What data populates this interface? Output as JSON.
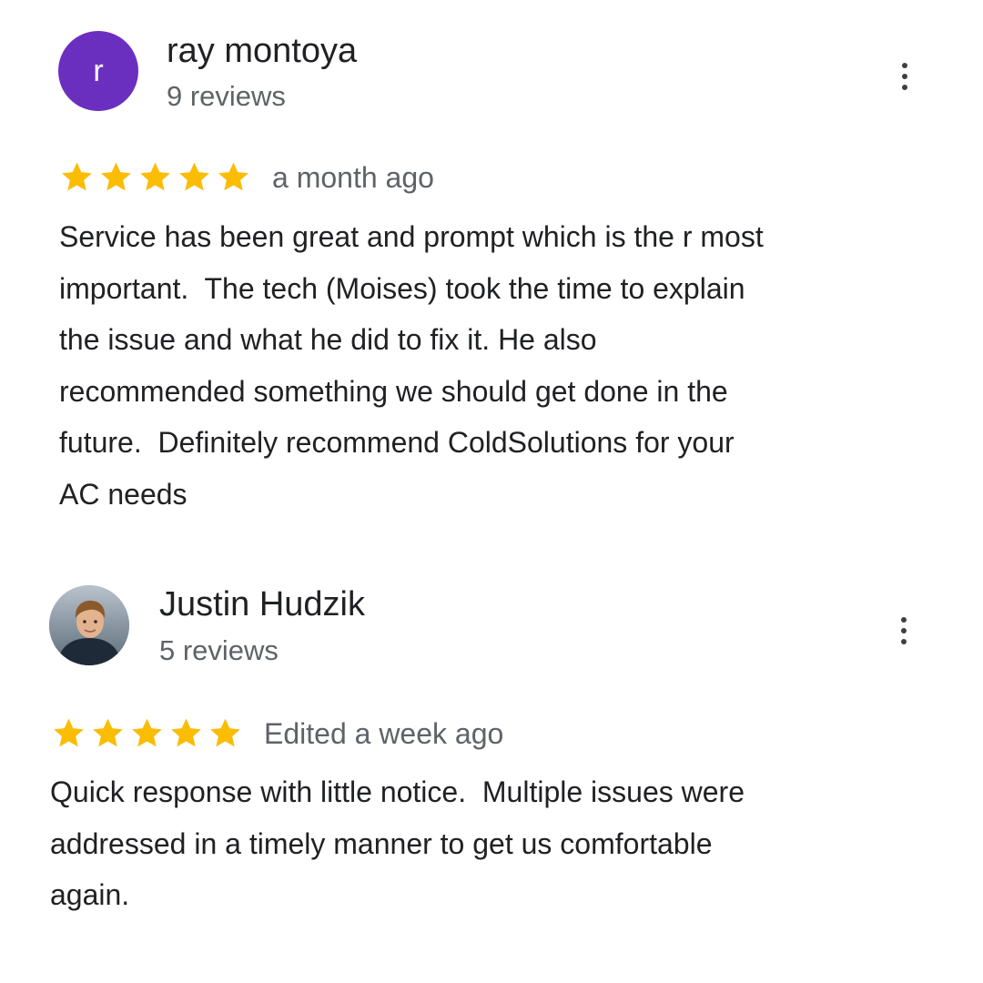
{
  "colors": {
    "star": "#fbbc04",
    "avatar_letter_bg": "#6b2fc0",
    "secondary_text": "#5f6368",
    "primary_text": "#202124"
  },
  "reviews": [
    {
      "author": "ray montoya",
      "avatar_letter": "r",
      "review_count": "9 reviews",
      "rating": 5,
      "date": "a month ago",
      "text_lines": [
        "Service has been great and prompt which is the r most",
        "important.  The tech (Moises) took the time to explain",
        "the issue and what he did to fix it. He also",
        "recommended something we should get done in the",
        "future.  Definitely recommend ColdSolutions for your",
        "AC needs"
      ]
    },
    {
      "author": "Justin Hudzik",
      "avatar_icon": "profile-photo",
      "review_count": "5 reviews",
      "rating": 5,
      "date": "Edited a week ago",
      "text_lines": [
        "Quick response with little notice.  Multiple issues were",
        "addressed in a timely manner to get us comfortable",
        "again."
      ]
    }
  ]
}
